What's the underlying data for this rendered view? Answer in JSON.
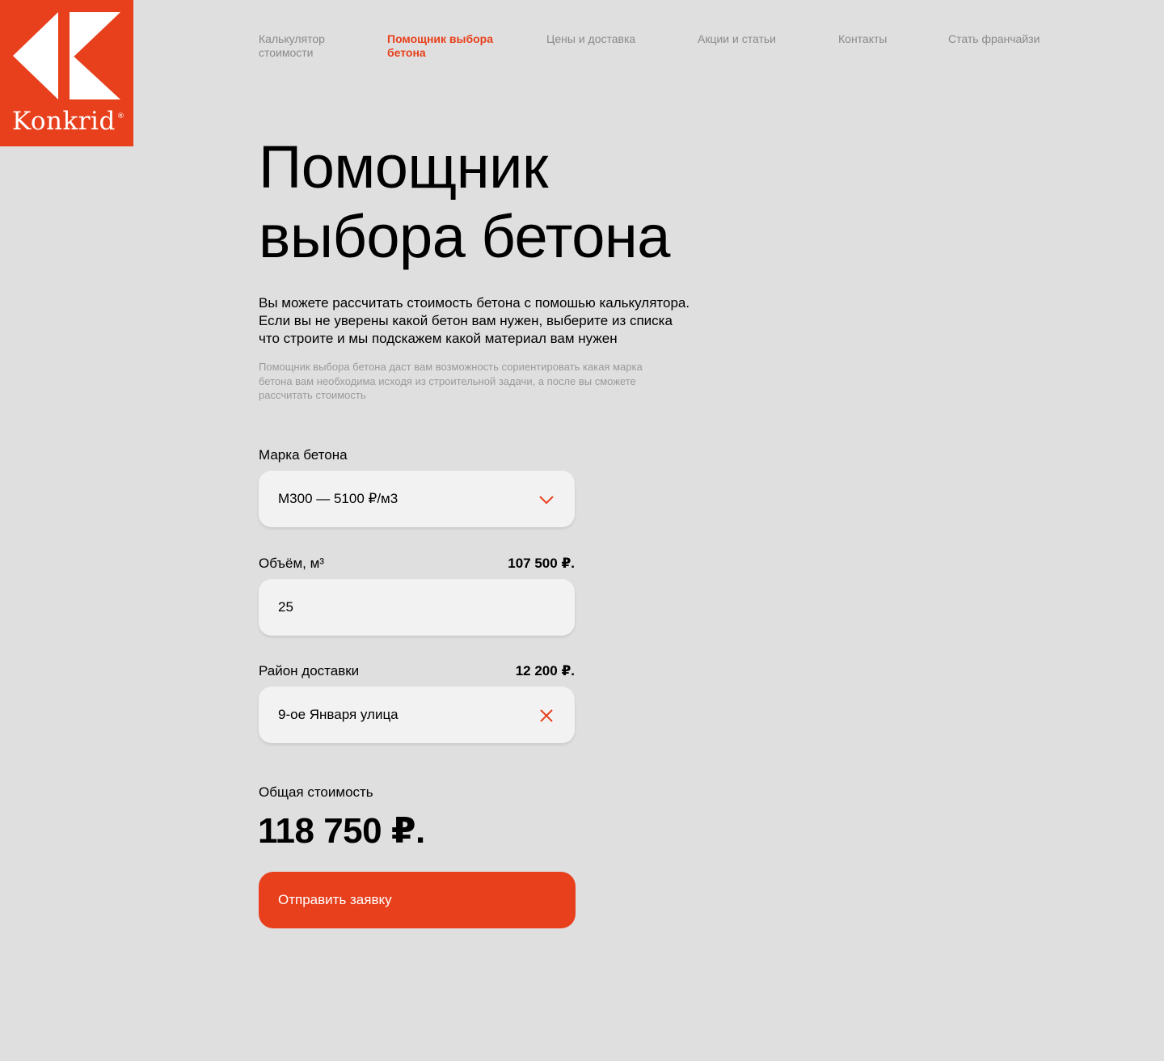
{
  "brand": {
    "name": "Konkrid",
    "reg_mark": "®",
    "color": "#e8401c"
  },
  "nav": {
    "items": [
      {
        "label_line1": "Калькулятор",
        "label_line2": "стоимости",
        "active": false
      },
      {
        "label_line1": "Помощник выбора",
        "label_line2": "бетона",
        "active": true
      },
      {
        "label_line1": "Цены и доставка",
        "label_line2": "",
        "active": false
      },
      {
        "label_line1": "Акции и статьи",
        "label_line2": "",
        "active": false
      },
      {
        "label_line1": "Контакты",
        "label_line2": "",
        "active": false
      },
      {
        "label_line1": "Стать франчайзи",
        "label_line2": "",
        "active": false
      }
    ]
  },
  "page": {
    "title_line1": "Помощник",
    "title_line2": "выбора бетона",
    "lead_line1": "Вы можете рассчитать стоимость бетона с помошью калькулятора.",
    "lead_line2": "Если вы не уверены какой бетон вам нужен, выберите из списка",
    "lead_line3": "что строите и мы подскажем какой материал вам нужен",
    "note_line1": "Помощник выбора бетона даст вам возможность сориентировать какая марка",
    "note_line2": "бетона вам необходима исходя из строительной задачи, а после вы сможете",
    "note_line3": "рассчитать стоимость"
  },
  "form": {
    "grade": {
      "label": "Марка бетона",
      "value": "М300 — 5100 ₽/м3",
      "icon": "chevron-down-icon"
    },
    "volume": {
      "label": "Объём, м³",
      "price": "107 500 ₽.",
      "value": "25"
    },
    "district": {
      "label": "Район доставки",
      "price": "12 200 ₽.",
      "value": "9-ое Января улица",
      "icon": "close-icon"
    },
    "total": {
      "label": "Общая стоимость",
      "value": "118 750 ₽."
    },
    "submit_label": "Отправить заявку"
  }
}
